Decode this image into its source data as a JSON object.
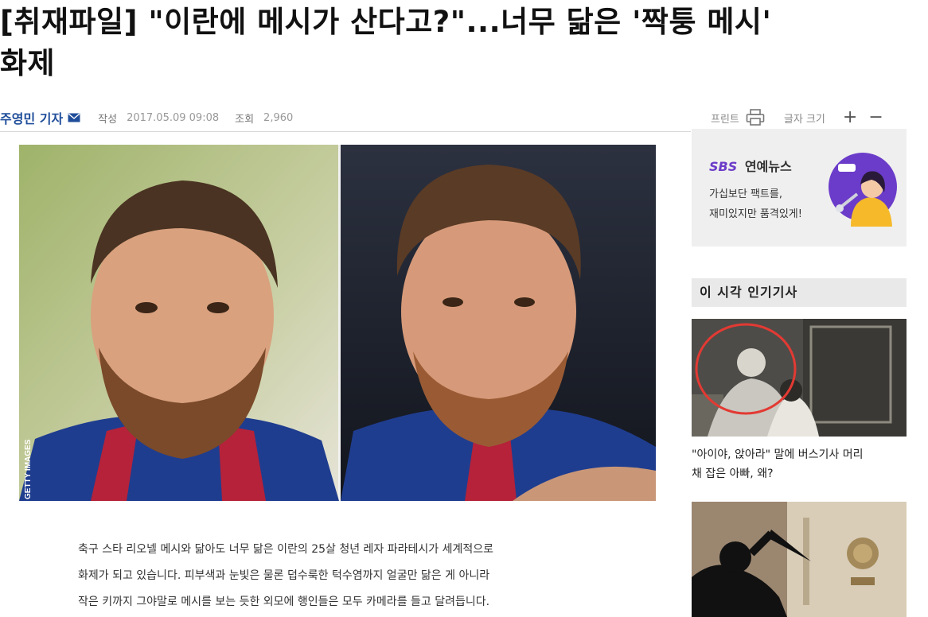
{
  "article": {
    "headline_line1": "[취재파일] \"이란에 메시가 산다고?\"...너무 닮은 '짝퉁 메시'",
    "headline_line2": "화제",
    "reporter": "주영민 기자",
    "written_label": "작성",
    "written_value": "2017.05.09 09:08",
    "views_label": "조회",
    "views_value": "2,960",
    "photo_credit": "GETTY IMAGES",
    "body_lines": [
      "축구 스타 리오넬 메시와 닮아도 너무 닮은 이란의 25살 청년 레자 파라테시가 세계적으로",
      "화제가 되고 있습니다. 피부색과 눈빛은 물론 덥수룩한 턱수염까지 얼굴만 닮은 게 아니라",
      "작은 키까지 그야말로 메시를 보는 듯한 외모에 행인들은 모두 카메라를 들고 달려듭니다."
    ]
  },
  "tools": {
    "print_label": "프린트",
    "font_size_label": "글자 크기",
    "plus": "+",
    "minus": "−"
  },
  "ad": {
    "brand_sbs": "SBS",
    "brand_name": "연예뉴스",
    "copy_line1": "가십보단 팩트를,",
    "copy_line2": "재미있지만 품격있게!"
  },
  "popular": {
    "heading": "이 시각 인기기사",
    "item1_line1": "\"아이야, 앉아라\" 말에 버스기사 머리",
    "item1_line2": "채 잡은 아빠, 왜?"
  },
  "colors": {
    "reporter": "#1f4d9a",
    "sbs_purple": "#6b3cc9",
    "section_bg": "#e9e9e9"
  }
}
